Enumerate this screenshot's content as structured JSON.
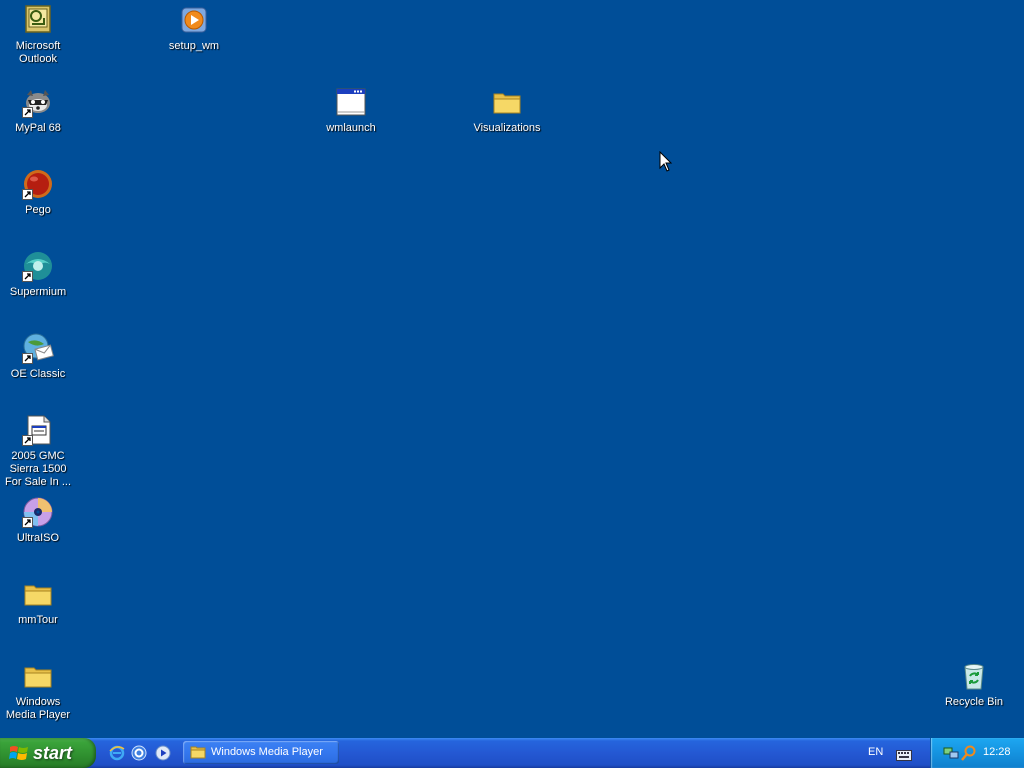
{
  "desktop": {
    "background_color": "#004e98",
    "icons": [
      {
        "label": "Microsoft Outlook",
        "icon": "outlook-icon"
      },
      {
        "label": "setup_wm",
        "icon": "media-player-setup-icon"
      },
      {
        "label": "MyPal 68",
        "icon": "mypal-raccoon-icon"
      },
      {
        "label": "wmlaunch",
        "icon": "application-window-icon"
      },
      {
        "label": "Visualizations",
        "icon": "folder-icon"
      },
      {
        "label": "Pego",
        "icon": "pego-red-ball-icon"
      },
      {
        "label": "Supermium",
        "icon": "supermium-globe-icon"
      },
      {
        "label": "OE Classic",
        "icon": "oe-classic-mail-icon"
      },
      {
        "label": "2005 GMC Sierra 1500 For Sale In ...",
        "icon": "web-document-icon"
      },
      {
        "label": "UltraISO",
        "icon": "ultraiso-disc-icon"
      },
      {
        "label": "mmTour",
        "icon": "folder-icon"
      },
      {
        "label": "Windows Media Player",
        "icon": "folder-icon"
      },
      {
        "label": "Recycle Bin",
        "icon": "recycle-bin-icon"
      }
    ]
  },
  "taskbar": {
    "start_label": "start",
    "quick_launch": [
      "internet-explorer-icon",
      "ie-alt-icon",
      "media-player-icon"
    ],
    "task_button_label": "Windows Media Player",
    "language": "EN",
    "clock": "12:28",
    "tray_icons": [
      "network-icon",
      "search-icon"
    ]
  }
}
